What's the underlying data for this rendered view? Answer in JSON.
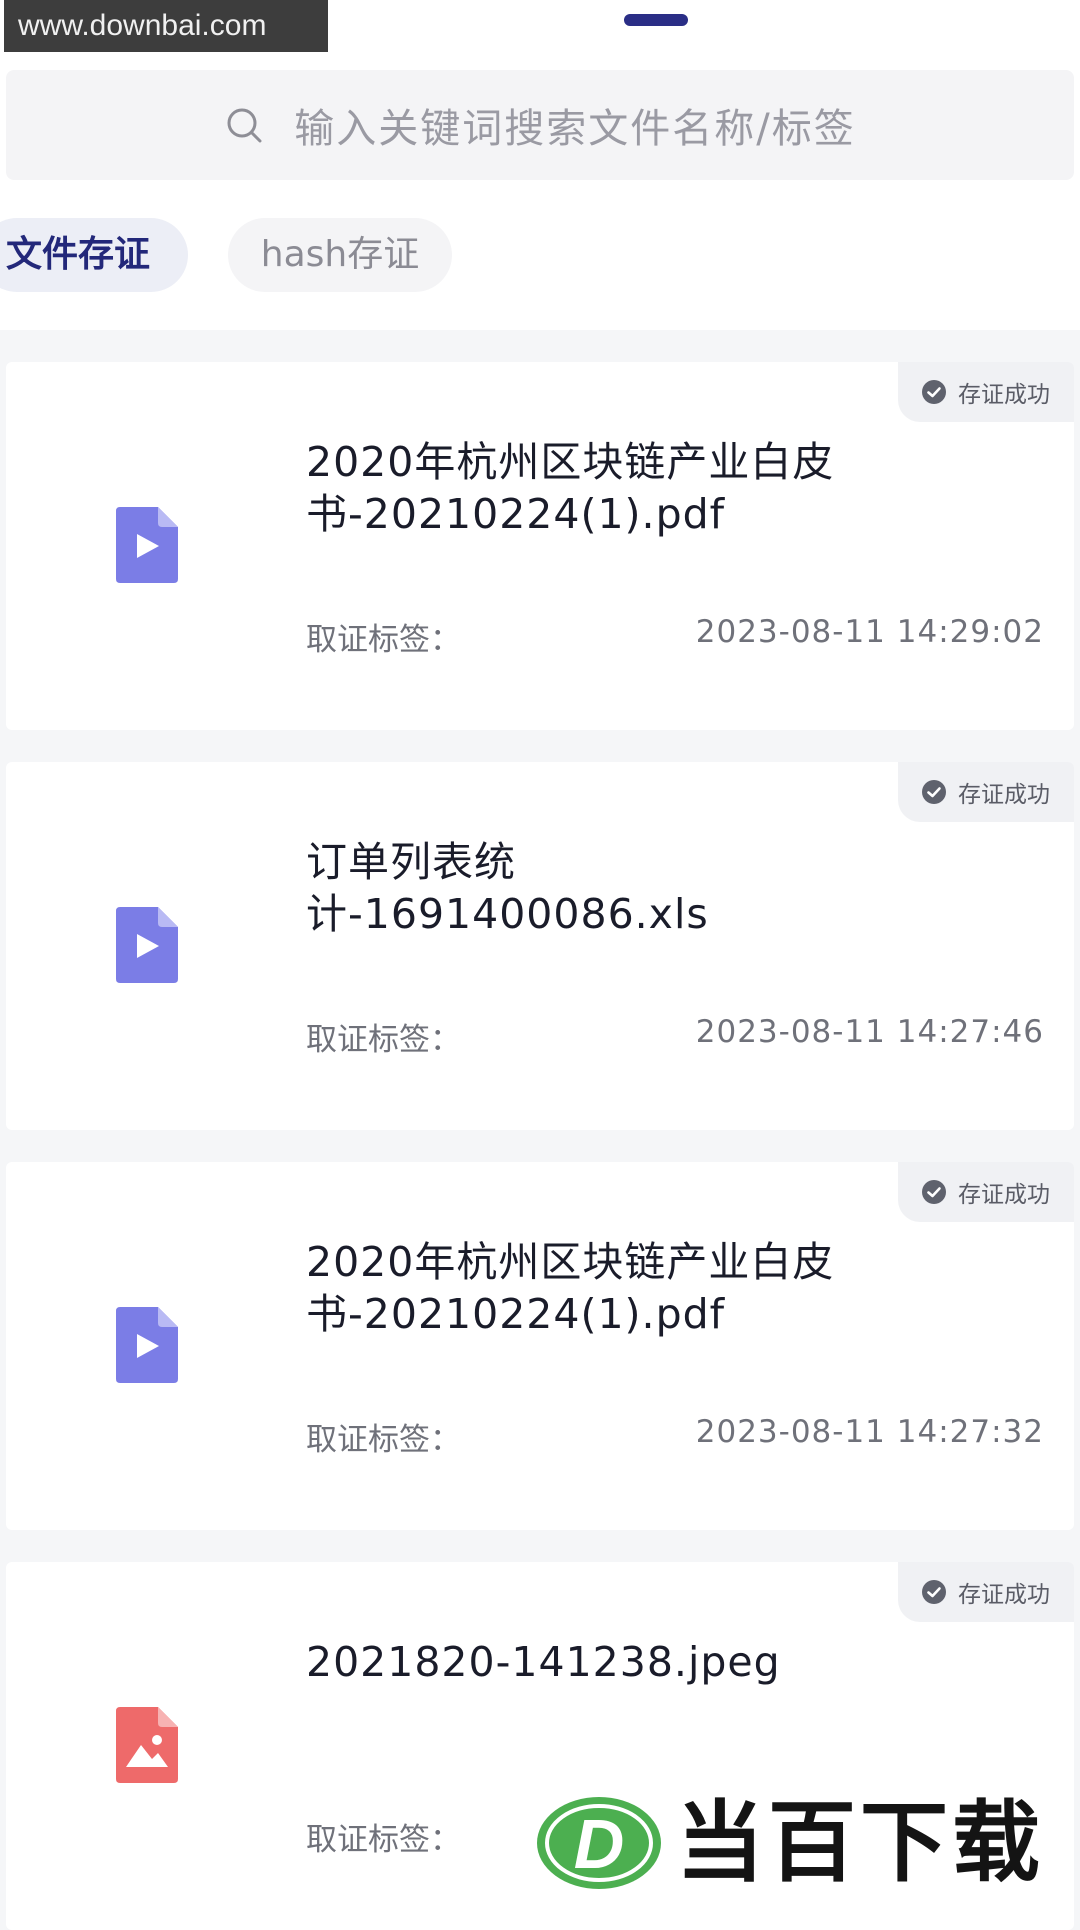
{
  "watermark_top": "www.downbai.com",
  "search": {
    "placeholder": "输入关键词搜索文件名称/标签"
  },
  "tabs": [
    {
      "label": "文件存证",
      "active": true
    },
    {
      "label": "hash存证",
      "active": false
    }
  ],
  "records": [
    {
      "status": "存证成功",
      "file_name": "2020年杭州区块链产业白皮书-20210224(1).pdf",
      "tag_label": "取证标签：",
      "time": "2023-08-11 14:29:02",
      "icon": "video-file-icon"
    },
    {
      "status": "存证成功",
      "file_name": "订单列表统计-1691400086.xls",
      "tag_label": "取证标签：",
      "time": "2023-08-11 14:27:46",
      "icon": "video-file-icon"
    },
    {
      "status": "存证成功",
      "file_name": "2020年杭州区块链产业白皮书-20210224(1).pdf",
      "tag_label": "取证标签：",
      "time": "2023-08-11 14:27:32",
      "icon": "video-file-icon"
    },
    {
      "status": "存证成功",
      "file_name": "2021820-141238.jpeg",
      "tag_label": "取证标签：",
      "time": "",
      "icon": "image-file-icon"
    }
  ],
  "brand_watermark": {
    "letter": "D",
    "text": "当百下载"
  },
  "colors": {
    "accent": "#23287a",
    "video_icon": "#7b7de6",
    "image_icon": "#ee6a6a",
    "brand_green": "#4caf50"
  }
}
